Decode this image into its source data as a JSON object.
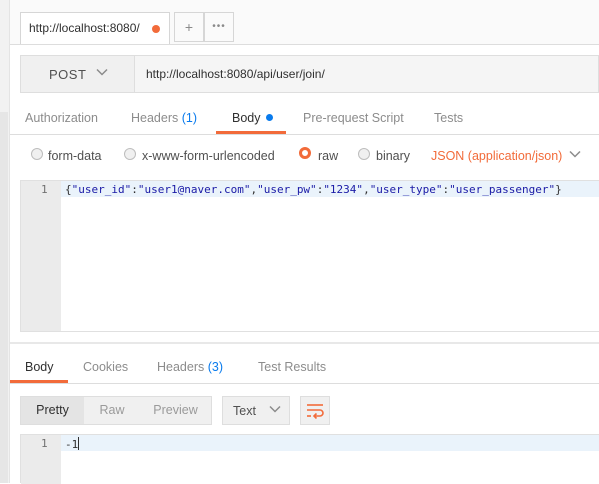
{
  "tab": {
    "label": "http://localhost:8080/",
    "unsaved_color": "#f26b3a"
  },
  "tab_actions": {
    "add": "+",
    "more": "•••"
  },
  "request": {
    "method": "POST",
    "url": "http://localhost:8080/api/user/join/"
  },
  "request_tabs": {
    "authorization": "Authorization",
    "headers": "Headers",
    "headers_count": "(1)",
    "body": "Body",
    "prerequest": "Pre-request Script",
    "tests": "Tests",
    "active": "Body"
  },
  "body_types": {
    "form_data": "form-data",
    "urlencoded": "x-www-form-urlencoded",
    "raw": "raw",
    "binary": "binary",
    "selected": "raw",
    "content_type": "JSON (application/json)"
  },
  "request_body": {
    "line_number": "1",
    "p1": "{",
    "k1": "\"user_id\"",
    "c1": ":",
    "v1": "\"user1@naver.com\"",
    "s1": ",",
    "k2": "\"user_pw\"",
    "c2": ":",
    "v2": "\"1234\"",
    "s2": ",",
    "k3": "\"user_type\"",
    "c3": ":",
    "v3": "\"user_passenger\"",
    "p2": "}"
  },
  "response_tabs": {
    "body": "Body",
    "cookies": "Cookies",
    "headers": "Headers",
    "headers_count": "(3)",
    "test_results": "Test Results",
    "active": "Body"
  },
  "view": {
    "pretty": "Pretty",
    "raw": "Raw",
    "preview": "Preview",
    "active": "Pretty",
    "format": "Text"
  },
  "response_body": {
    "line_number": "1",
    "text": "-1"
  },
  "colors": {
    "accent": "#f26b3a",
    "link": "#097bed",
    "string": "#1a1aa6"
  }
}
